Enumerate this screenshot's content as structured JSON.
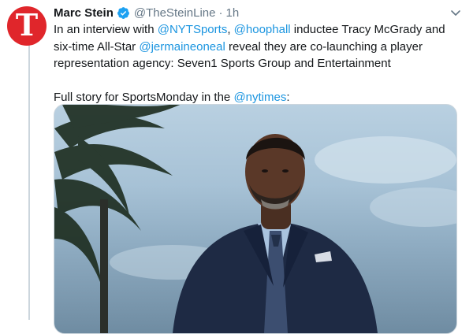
{
  "tweet": {
    "author_name": "Marc Stein",
    "handle": "@TheSteinLine",
    "separator": "·",
    "time": "1h",
    "avatar_glyph": "T",
    "text": {
      "seg1": "In an interview with ",
      "mention1": "@NYTSports",
      "seg2": ", ",
      "mention2": "@hoophall",
      "seg3": " inductee Tracy McGrady and six-time All-Star ",
      "mention3": "@jermaineoneal",
      "seg4": " reveal they are co-launching a player representation agency: Seven1 Sports Group and Entertainment",
      "para2_lead": "Full story for SportsMonday in the ",
      "mention4": "@nytimes",
      "para2_tail": ":"
    }
  },
  "colors": {
    "link": "#1b95e0",
    "avatar_bg": "#e0262b",
    "secondary": "#657786"
  },
  "icons": {
    "verified": "verified-badge-icon",
    "more": "chevron-down-icon"
  }
}
